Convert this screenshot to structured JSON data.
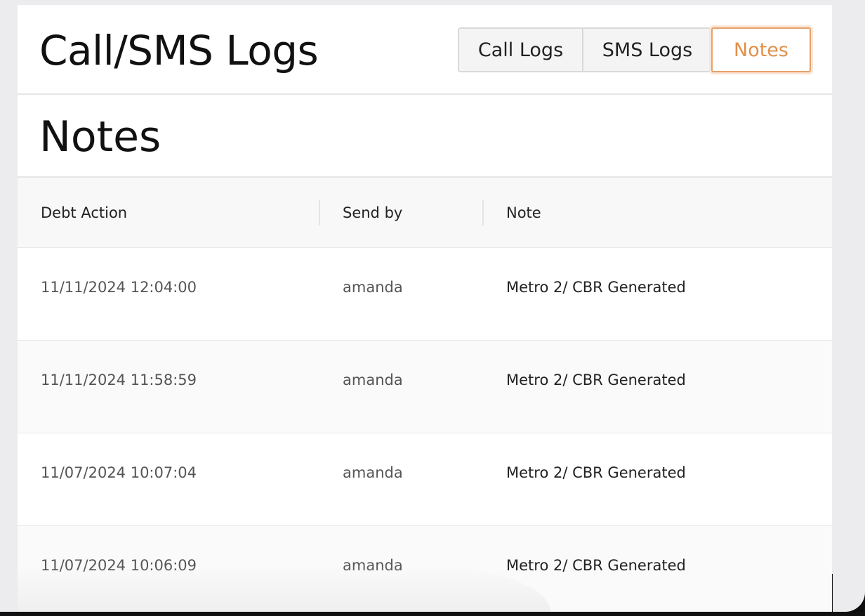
{
  "header": {
    "title": "Call/SMS Logs",
    "tabs": [
      {
        "label": "Call Logs",
        "active": false
      },
      {
        "label": "SMS Logs",
        "active": false
      },
      {
        "label": "Notes",
        "active": true
      }
    ]
  },
  "section": {
    "title": "Notes"
  },
  "table": {
    "columns": [
      "Debt Action",
      "Send by",
      "Note"
    ],
    "rows": [
      {
        "debt_action": "11/11/2024 12:04:00",
        "send_by": "amanda",
        "note": "Metro 2/ CBR Generated"
      },
      {
        "debt_action": "11/11/2024 11:58:59",
        "send_by": "amanda",
        "note": "Metro 2/ CBR Generated"
      },
      {
        "debt_action": "11/07/2024 10:07:04",
        "send_by": "amanda",
        "note": "Metro 2/ CBR Generated"
      },
      {
        "debt_action": "11/07/2024 10:06:09",
        "send_by": "amanda",
        "note": "Metro 2/ CBR Generated"
      }
    ]
  },
  "colors": {
    "accent": "#e0914b",
    "accent_border": "#e8a06a",
    "background": "#ececee",
    "card": "#ffffff"
  }
}
